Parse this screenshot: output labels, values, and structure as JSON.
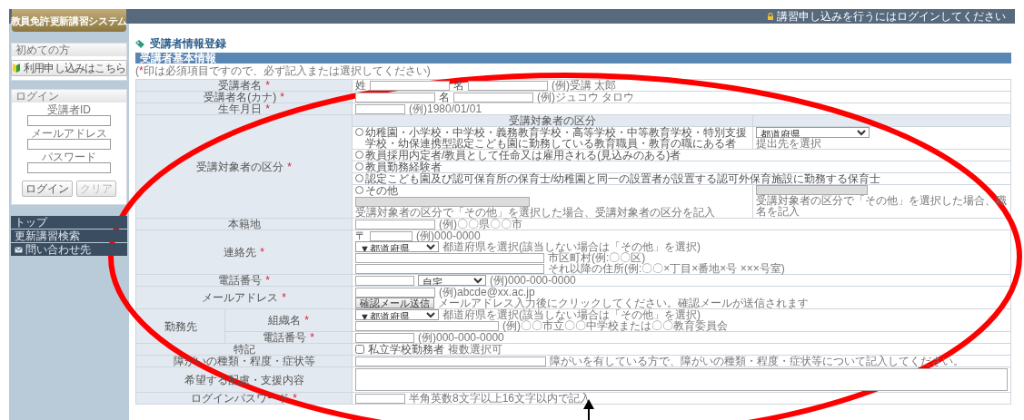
{
  "header": {
    "logo": "教員免許更新講習システム",
    "login_notice": "講習申し込みを行うにはログインしてください"
  },
  "sidebar": {
    "first_time": {
      "title": "初めての方",
      "button": "利用申し込みはこちら"
    },
    "login": {
      "title": "ログイン",
      "fields": [
        {
          "label": "受講者ID"
        },
        {
          "label": "メールアドレス"
        },
        {
          "label": "パスワード"
        }
      ],
      "buttons": [
        {
          "label": "ログイン",
          "disabled": false
        },
        {
          "label": "クリア",
          "disabled": true
        }
      ]
    },
    "nav": [
      {
        "label": "トップ",
        "has_icon": false
      },
      {
        "label": "更新講習検索",
        "has_icon": false
      },
      {
        "label": "問い合わせ先",
        "has_icon": true
      }
    ]
  },
  "page_title": "受講者情報登録",
  "section": "受講者基本情報",
  "required_mark": "*",
  "note": {
    "open": "(",
    "mark": "*",
    "text": "印は必須項目ですので、必ず記入または選択してください)"
  },
  "rows": [
    {
      "kind": "simple",
      "label": "受講者名",
      "required": true,
      "lines": [
        [
          {
            "kind": "text",
            "text": "姓"
          },
          {
            "kind": "input",
            "disabled": false
          },
          {
            "kind": "text",
            "text": "名"
          },
          {
            "kind": "input",
            "disabled": false
          },
          {
            "kind": "hint",
            "text": "(例)受講 太郎"
          }
        ]
      ]
    },
    {
      "kind": "simple",
      "label": "受講者名(カナ)",
      "required": true,
      "lines": [
        [
          {
            "kind": "input",
            "disabled": false
          },
          {
            "kind": "text",
            "text": "名"
          },
          {
            "kind": "input",
            "disabled": false
          },
          {
            "kind": "hint",
            "text": "(例)ジュコウ タロウ"
          }
        ]
      ]
    },
    {
      "kind": "simple",
      "label": "生年月日",
      "required": true,
      "lines": [
        [
          {
            "kind": "input",
            "disabled": false
          },
          {
            "kind": "hint",
            "text": "(例)1980/01/01"
          }
        ]
      ]
    },
    {
      "kind": "choice",
      "label": "受講対象者の区分",
      "required": true,
      "headers": [
        "受講対象者の区分"
      ],
      "options": [
        {
          "label": "幼稚園・小学校・中学校・義務教育学校・高等学校・中等教育学校・特別支援学校・幼保連携型認定こども園に勤務している教育職員・教育の職にある者",
          "selected": false,
          "side": [
            [
              {
                "kind": "select",
                "value": "都道府県"
              }
            ],
            [
              {
                "kind": "hint",
                "text": "提出先を選択"
              }
            ]
          ]
        },
        {
          "label": "教員採用内定者/教員として任命又は雇用される(見込みのある)者",
          "selected": false
        },
        {
          "label": "教員勤務経験者",
          "selected": false
        },
        {
          "label": "認定こども園及び認可保育所の保育士/幼稚園と同一の設置者が設置する認可外保育施設に勤務する保育士",
          "selected": false
        },
        {
          "label": "その他",
          "selected": false,
          "lines": [
            [
              {
                "kind": "input",
                "disabled": true
              }
            ],
            [
              {
                "kind": "hint",
                "text": "受講対象者の区分で「その他」を選択した場合、受講対象者の区分を記入"
              }
            ]
          ],
          "side": [
            [
              {
                "kind": "input",
                "disabled": true
              }
            ],
            [
              {
                "kind": "hint",
                "text": "受講対象者の区分で「その他」を選択した場合、職名を記入"
              }
            ]
          ]
        }
      ]
    },
    {
      "kind": "simple",
      "label": "本籍地",
      "required": false,
      "lines": [
        [
          {
            "kind": "input",
            "disabled": false
          },
          {
            "kind": "hint",
            "text": "(例)〇〇県〇〇市"
          }
        ]
      ]
    },
    {
      "kind": "simple",
      "label": "連絡先",
      "required": true,
      "lines": [
        [
          {
            "kind": "text",
            "text": "〒"
          },
          {
            "kind": "input",
            "disabled": false
          },
          {
            "kind": "hint",
            "text": "(例)000-0000"
          }
        ],
        [
          {
            "kind": "select",
            "value": "▼都道府県"
          },
          {
            "kind": "hint",
            "text": "都道府県を選択(該当しない場合は「その他」を選択)"
          }
        ],
        [
          {
            "kind": "input",
            "disabled": false
          },
          {
            "kind": "hint",
            "text": "市区町村(例:〇〇区)"
          }
        ],
        [
          {
            "kind": "input",
            "disabled": false
          },
          {
            "kind": "hint",
            "text": "それ以降の住所(例:〇〇×丁目×番地×号 ×××号室)"
          }
        ]
      ]
    },
    {
      "kind": "simple",
      "label": "電話番号",
      "required": true,
      "lines": [
        [
          {
            "kind": "input",
            "disabled": false
          },
          {
            "kind": "select",
            "value": "自宅"
          },
          {
            "kind": "hint",
            "text": "(例)000-000-0000"
          }
        ]
      ]
    },
    {
      "kind": "simple",
      "label": "メールアドレス",
      "required": true,
      "lines": [
        [
          {
            "kind": "input",
            "disabled": false
          },
          {
            "kind": "hint",
            "text": "(例)abcde@xx.ac.jp"
          }
        ],
        [
          {
            "kind": "button",
            "text": "確認メール送信"
          },
          {
            "kind": "hint",
            "text": "メールアドレス入力後にクリックしてください。確認メールが送信されます"
          }
        ]
      ]
    },
    {
      "kind": "group",
      "label": "勤務先",
      "required": false,
      "subrows": [
        {
          "label": "組織名",
          "required": true,
          "lines": [
            [
              {
                "kind": "select",
                "value": "▼都道府県"
              },
              {
                "kind": "hint",
                "text": "都道府県を選択(該当しない場合は「その他」を選択)"
              }
            ],
            [
              {
                "kind": "input",
                "disabled": false
              },
              {
                "kind": "hint",
                "text": "(例)〇〇市立〇〇中学校または〇〇教育委員会"
              }
            ]
          ]
        },
        {
          "label": "電話番号",
          "required": true,
          "lines": [
            [
              {
                "kind": "input",
                "disabled": false
              },
              {
                "kind": "hint",
                "text": "(例)000-000-0000"
              }
            ]
          ]
        }
      ]
    },
    {
      "kind": "simple",
      "label": "特記",
      "required": false,
      "lines": [
        [
          {
            "kind": "checkbox",
            "text": "私立学校勤務者",
            "checked": false
          },
          {
            "kind": "hint",
            "text": "複数選択可"
          }
        ]
      ]
    },
    {
      "kind": "simple",
      "label": "障がいの種類・程度・症状等",
      "required": false,
      "lines": [
        [
          {
            "kind": "input",
            "disabled": false
          },
          {
            "kind": "hint",
            "text": "障がいを有している方で、障がいの種類・程度・症状等について記入してください。"
          }
        ]
      ]
    },
    {
      "kind": "simple",
      "label": "希望する配慮・支援内容",
      "required": false,
      "lines": [
        [
          {
            "kind": "textarea"
          }
        ]
      ]
    },
    {
      "kind": "simple",
      "label": "ログインパスワード",
      "required": true,
      "lines": [
        [
          {
            "kind": "input",
            "disabled": false
          },
          {
            "kind": "hint",
            "text": "半角英数8文字以上16文字以内で記入"
          }
        ]
      ]
    }
  ]
}
